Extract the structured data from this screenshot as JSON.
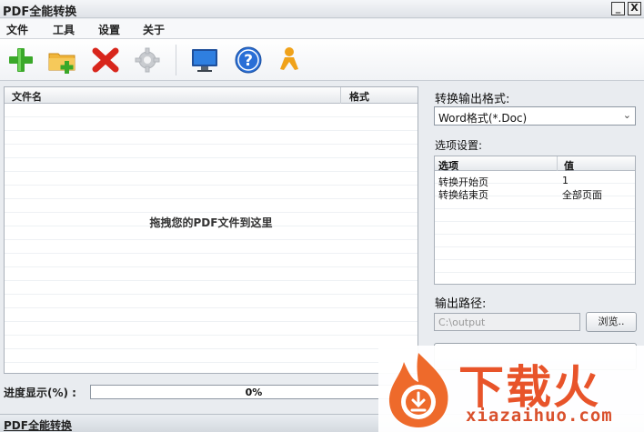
{
  "window": {
    "title": "PDF全能转换",
    "minimize_symbol": "_",
    "close_symbol": "X"
  },
  "menu": {
    "items": [
      "文件",
      "工具",
      "设置",
      "关于"
    ]
  },
  "toolbar": {
    "buttons": [
      {
        "icon": "add-icon"
      },
      {
        "icon": "add-folder-icon"
      },
      {
        "icon": "delete-icon"
      },
      {
        "icon": "gear-icon"
      },
      {
        "icon": "monitor-icon"
      },
      {
        "icon": "help-icon"
      },
      {
        "icon": "user-icon"
      }
    ]
  },
  "file_list": {
    "columns": [
      "文件名",
      "格式"
    ],
    "drop_hint": "拖拽您的PDF文件到这里"
  },
  "output_format": {
    "label": "转换输出格式:",
    "selected": "Word格式(*.Doc)"
  },
  "options": {
    "label": "选项设置:",
    "columns": [
      "选项",
      "值"
    ],
    "rows": [
      {
        "option": "转换开始页",
        "value": "1"
      },
      {
        "option": "转换结束页",
        "value": "全部页面"
      }
    ]
  },
  "output_path": {
    "label": "输出路径:",
    "value": "C:\\output",
    "browse_label": "浏览.."
  },
  "progress": {
    "label": "进度显示(%) :",
    "percent": 0,
    "text": "0%"
  },
  "status": {
    "text": "PDF全能转换"
  },
  "watermark": {
    "brand_cn": "下载火",
    "brand_en": "xiazaihuo.com"
  },
  "colors": {
    "accent_green": "#3aa829",
    "delete_red": "#d8261c",
    "help_blue": "#2a6fd6",
    "user_orange": "#f0a21a",
    "watermark_orange": "#e8542a"
  }
}
